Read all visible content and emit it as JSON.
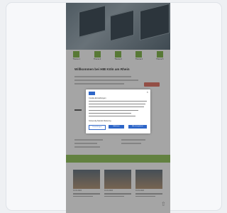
{
  "page": {
    "welcome_title": "Willkommen bei HIB Köln am Rhein"
  },
  "navigation": {
    "items": [
      {
        "label": "Thema 1"
      },
      {
        "label": "Thema 2"
      },
      {
        "label": "Thema 3"
      },
      {
        "label": "Thema 4"
      },
      {
        "label": "Thema 5"
      }
    ]
  },
  "cookie_dialog": {
    "title": "Cookie-Einstellungen",
    "options_label": "Notwendig  Statistik  Marketing",
    "buttons": {
      "settings": "Einstellungen",
      "reject": "Ablehnen",
      "accept": "Alle akzeptieren"
    },
    "close_symbol": "×"
  },
  "news": [
    {
      "date": "01.01.2024"
    },
    {
      "date": "01.01.2024"
    },
    {
      "date": "01.01.2024"
    }
  ],
  "scroll_up_symbol": "⇧",
  "colors": {
    "accent_green": "#8cc152",
    "primary_blue": "#2e66c8"
  }
}
